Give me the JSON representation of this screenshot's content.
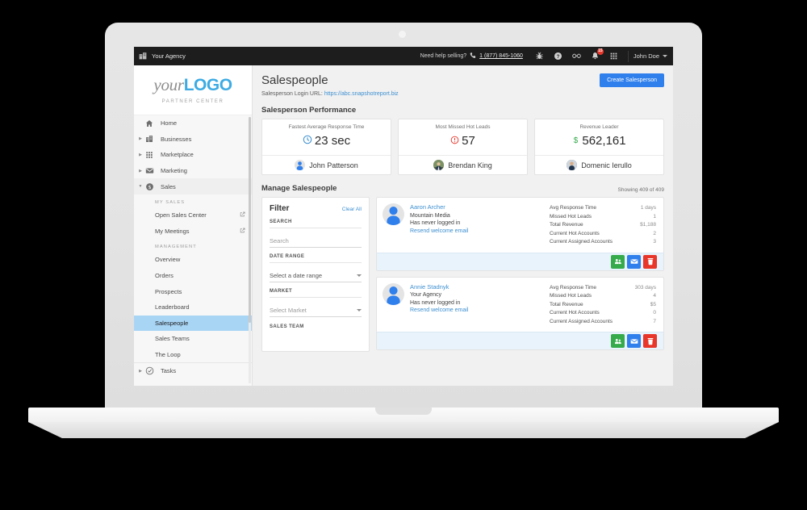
{
  "topbar": {
    "agency_icon": "building-icon",
    "agency_label": "Your Agency",
    "help_text": "Need help selling?",
    "phone_icon": "phone-icon",
    "phone_number": "1 (877) 845-1060",
    "icons": [
      {
        "name": "bug-icon",
        "glyph": "☣"
      },
      {
        "name": "help-circle-icon",
        "glyph": "?"
      },
      {
        "name": "infinity-icon",
        "glyph": "∞"
      },
      {
        "name": "notifications-bell-icon",
        "glyph": "🔔",
        "badge": "15"
      },
      {
        "name": "apps-grid-icon",
        "glyph": "∷"
      }
    ],
    "user_name": "John Doe",
    "badge_color": "#e8362b"
  },
  "sidebar": {
    "logo": {
      "part1": "your",
      "part2": "LOGO",
      "subtitle": "PARTNER CENTER",
      "accent": "#3dabe3"
    },
    "items": [
      {
        "label": "Home",
        "icon": "home-icon",
        "expandable": false,
        "expanded": false
      },
      {
        "label": "Businesses",
        "icon": "businesses-building-icon",
        "expandable": true,
        "expanded": false
      },
      {
        "label": "Marketplace",
        "icon": "marketplace-grid-icon",
        "expandable": true,
        "expanded": false
      },
      {
        "label": "Marketing",
        "icon": "marketing-envelope-icon",
        "expandable": true,
        "expanded": false
      },
      {
        "label": "Sales",
        "icon": "sales-dollar-icon",
        "expandable": true,
        "expanded": true
      }
    ],
    "groups": [
      {
        "label": "MY SALES",
        "items": [
          {
            "label": "Open Sales Center",
            "external": true,
            "active": false
          },
          {
            "label": "My Meetings",
            "external": true,
            "active": false
          }
        ]
      },
      {
        "label": "MANAGEMENT",
        "items": [
          {
            "label": "Overview",
            "external": false,
            "active": false
          },
          {
            "label": "Orders",
            "external": false,
            "active": false
          },
          {
            "label": "Prospects",
            "external": false,
            "active": false
          },
          {
            "label": "Leaderboard",
            "external": false,
            "active": false
          },
          {
            "label": "Salespeople",
            "external": false,
            "active": true
          },
          {
            "label": "Sales Teams",
            "external": false,
            "active": false
          },
          {
            "label": "The Loop",
            "external": false,
            "active": false
          }
        ]
      }
    ],
    "trailing_items": [
      {
        "label": "Tasks",
        "icon": "tasks-check-icon",
        "expandable": true,
        "expanded": false
      }
    ],
    "active_color": "#a9d5f5"
  },
  "main": {
    "page_title": "Salespeople",
    "login_url_label": "Salesperson Login URL:",
    "login_url": "https://abc.snapshotreport.biz",
    "create_button": "Create Salesperson",
    "create_button_color": "#2f7fec",
    "performance_section_title": "Salesperson Performance",
    "performance_cards": [
      {
        "title": "Fastest Average Response Time",
        "value": "23 sec",
        "value_icon": "clock-icon",
        "value_icon_color": "#3c8fd0",
        "person": "John Patterson",
        "avatar": "silhouette-avatar"
      },
      {
        "title": "Most Missed Hot Leads",
        "value": "57",
        "value_icon": "alert-circle-icon",
        "value_icon_color": "#e8362b",
        "person": "Brendan King",
        "avatar": "photo-avatar"
      },
      {
        "title": "Revenue Leader",
        "value": "562,161",
        "value_icon": "dollar-icon",
        "value_icon_color": "#35ab4c",
        "person": "Domenic Ierullo",
        "avatar": "photo-avatar"
      }
    ],
    "manage_section_title": "Manage Salespeople",
    "showing_count": "Showing 409 of 409",
    "filter": {
      "title": "Filter",
      "clear_all": "Clear All",
      "groups": [
        {
          "label": "SEARCH",
          "value": "",
          "placeholder": "Search",
          "type": "text"
        },
        {
          "label": "DATE RANGE",
          "value": "Select a date range",
          "type": "select"
        },
        {
          "label": "MARKET",
          "value": "Select Market",
          "type": "select"
        }
      ],
      "cut_off_label": "SALES TEAM"
    },
    "stat_labels": [
      "Avg Response Time",
      "Missed Hot Leads",
      "Total Revenue",
      "Current Hot Accounts",
      "Current Assigned Accounts"
    ],
    "people": [
      {
        "name": "Aaron Archer",
        "company": "Mountain Media",
        "status": "Has never logged in",
        "resend_label": "Resend welcome email",
        "stats": [
          "1 days",
          "1",
          "$1,188",
          "2",
          "3"
        ],
        "actions": [
          {
            "name": "assign-accounts-button",
            "icon": "people-group-icon",
            "color": "#35ab4c"
          },
          {
            "name": "send-email-button",
            "icon": "envelope-icon",
            "color": "#2f7fec"
          },
          {
            "name": "delete-salesperson-button",
            "icon": "trash-icon",
            "color": "#e8362b"
          }
        ]
      },
      {
        "name": "Annie Stadnyk",
        "company": "Your Agency",
        "status": "Has never logged in",
        "resend_label": "Resend welcome email",
        "stats": [
          "303 days",
          "4",
          "$5",
          "0",
          "7"
        ],
        "actions": [
          {
            "name": "assign-accounts-button",
            "icon": "people-group-icon",
            "color": "#35ab4c"
          },
          {
            "name": "send-email-button",
            "icon": "envelope-icon",
            "color": "#2f7fec"
          },
          {
            "name": "delete-salesperson-button",
            "icon": "trash-icon",
            "color": "#e8362b"
          }
        ]
      }
    ]
  }
}
